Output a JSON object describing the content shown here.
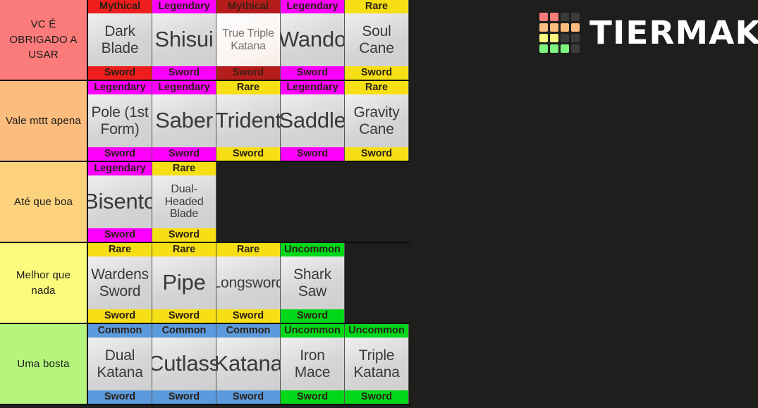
{
  "brand": {
    "name": "TIERMAKER",
    "logo_colors": {
      "red": "#fb7b7b",
      "orange": "#fcbc7d",
      "yellow": "#faf67f",
      "green": "#7ef47e",
      "empty": "#3b3b39"
    },
    "logo_grid": [
      [
        "red",
        "red",
        "empty",
        "empty"
      ],
      [
        "orange",
        "orange",
        "orange",
        "orange"
      ],
      [
        "yellow",
        "yellow",
        "empty",
        "empty"
      ],
      [
        "green",
        "green",
        "green",
        "empty"
      ]
    ]
  },
  "background_color": "#1e1e1c",
  "rarity_colors": {
    "Mythical": "#f01d1d",
    "Legendary": "#ff00ff",
    "Rare": "#f7df16",
    "Uncommon": "#00d819",
    "Common": "#5c9ade"
  },
  "tiers": [
    {
      "label": "VC É OBRIGADO A USAR",
      "color": "#fb7b7b",
      "items": [
        {
          "name": "Dark Blade",
          "rarity": "Mythical",
          "type": "Sword",
          "name_class": "two-line",
          "faded": false
        },
        {
          "name": "Shisui",
          "rarity": "Legendary",
          "type": "Sword",
          "name_class": "big",
          "faded": false
        },
        {
          "name": "True Triple Katana",
          "rarity": "Mythical",
          "type": "Sword",
          "name_class": "two-line small",
          "faded": true
        },
        {
          "name": "Wando",
          "rarity": "Legendary",
          "type": "Sword",
          "name_class": "big",
          "faded": false
        },
        {
          "name": "Soul Cane",
          "rarity": "Rare",
          "type": "Sword",
          "name_class": "two-line",
          "faded": false
        }
      ]
    },
    {
      "label": "Vale mttt apena",
      "color": "#fcbc7d",
      "items": [
        {
          "name": "Pole (1st Form)",
          "rarity": "Legendary",
          "type": "Sword",
          "name_class": "two-line",
          "faded": false
        },
        {
          "name": "Saber",
          "rarity": "Legendary",
          "type": "Sword",
          "name_class": "big",
          "faded": false
        },
        {
          "name": "Trident",
          "rarity": "Rare",
          "type": "Sword",
          "name_class": "big",
          "faded": false
        },
        {
          "name": "Saddle",
          "rarity": "Legendary",
          "type": "Sword",
          "name_class": "big",
          "faded": false
        },
        {
          "name": "Gravity Cane",
          "rarity": "Rare",
          "type": "Sword",
          "name_class": "two-line",
          "faded": false
        }
      ]
    },
    {
      "label": "Até que boa",
      "color": "#fcd27d",
      "items": [
        {
          "name": "Bisento",
          "rarity": "Legendary",
          "type": "Sword",
          "name_class": "big",
          "faded": false
        },
        {
          "name": "Dual-Headed Blade",
          "rarity": "Rare",
          "type": "Sword",
          "name_class": "two-line small",
          "faded": false
        }
      ]
    },
    {
      "label": "Melhor que nada",
      "color": "#fbfb7d",
      "items": [
        {
          "name": "Wardens Sword",
          "rarity": "Rare",
          "type": "Sword",
          "name_class": "two-line",
          "faded": false
        },
        {
          "name": "Pipe",
          "rarity": "Rare",
          "type": "Sword",
          "name_class": "big",
          "faded": false
        },
        {
          "name": "Longsword",
          "rarity": "Rare",
          "type": "Sword",
          "name_class": "",
          "faded": false
        },
        {
          "name": "Shark Saw",
          "rarity": "Uncommon",
          "type": "Sword",
          "name_class": "two-line",
          "faded": false
        }
      ]
    },
    {
      "label": "Uma bosta",
      "color": "#b5f47d",
      "items": [
        {
          "name": "Dual Katana",
          "rarity": "Common",
          "type": "Sword",
          "name_class": "two-line",
          "faded": false
        },
        {
          "name": "Cutlass",
          "rarity": "Common",
          "type": "Sword",
          "name_class": "big",
          "faded": false
        },
        {
          "name": "Katana",
          "rarity": "Common",
          "type": "Sword",
          "name_class": "big",
          "faded": false
        },
        {
          "name": "Iron Mace",
          "rarity": "Uncommon",
          "type": "Sword",
          "name_class": "two-line",
          "faded": false
        },
        {
          "name": "Triple Katana",
          "rarity": "Uncommon",
          "type": "Sword",
          "name_class": "two-line",
          "faded": false
        }
      ]
    }
  ]
}
